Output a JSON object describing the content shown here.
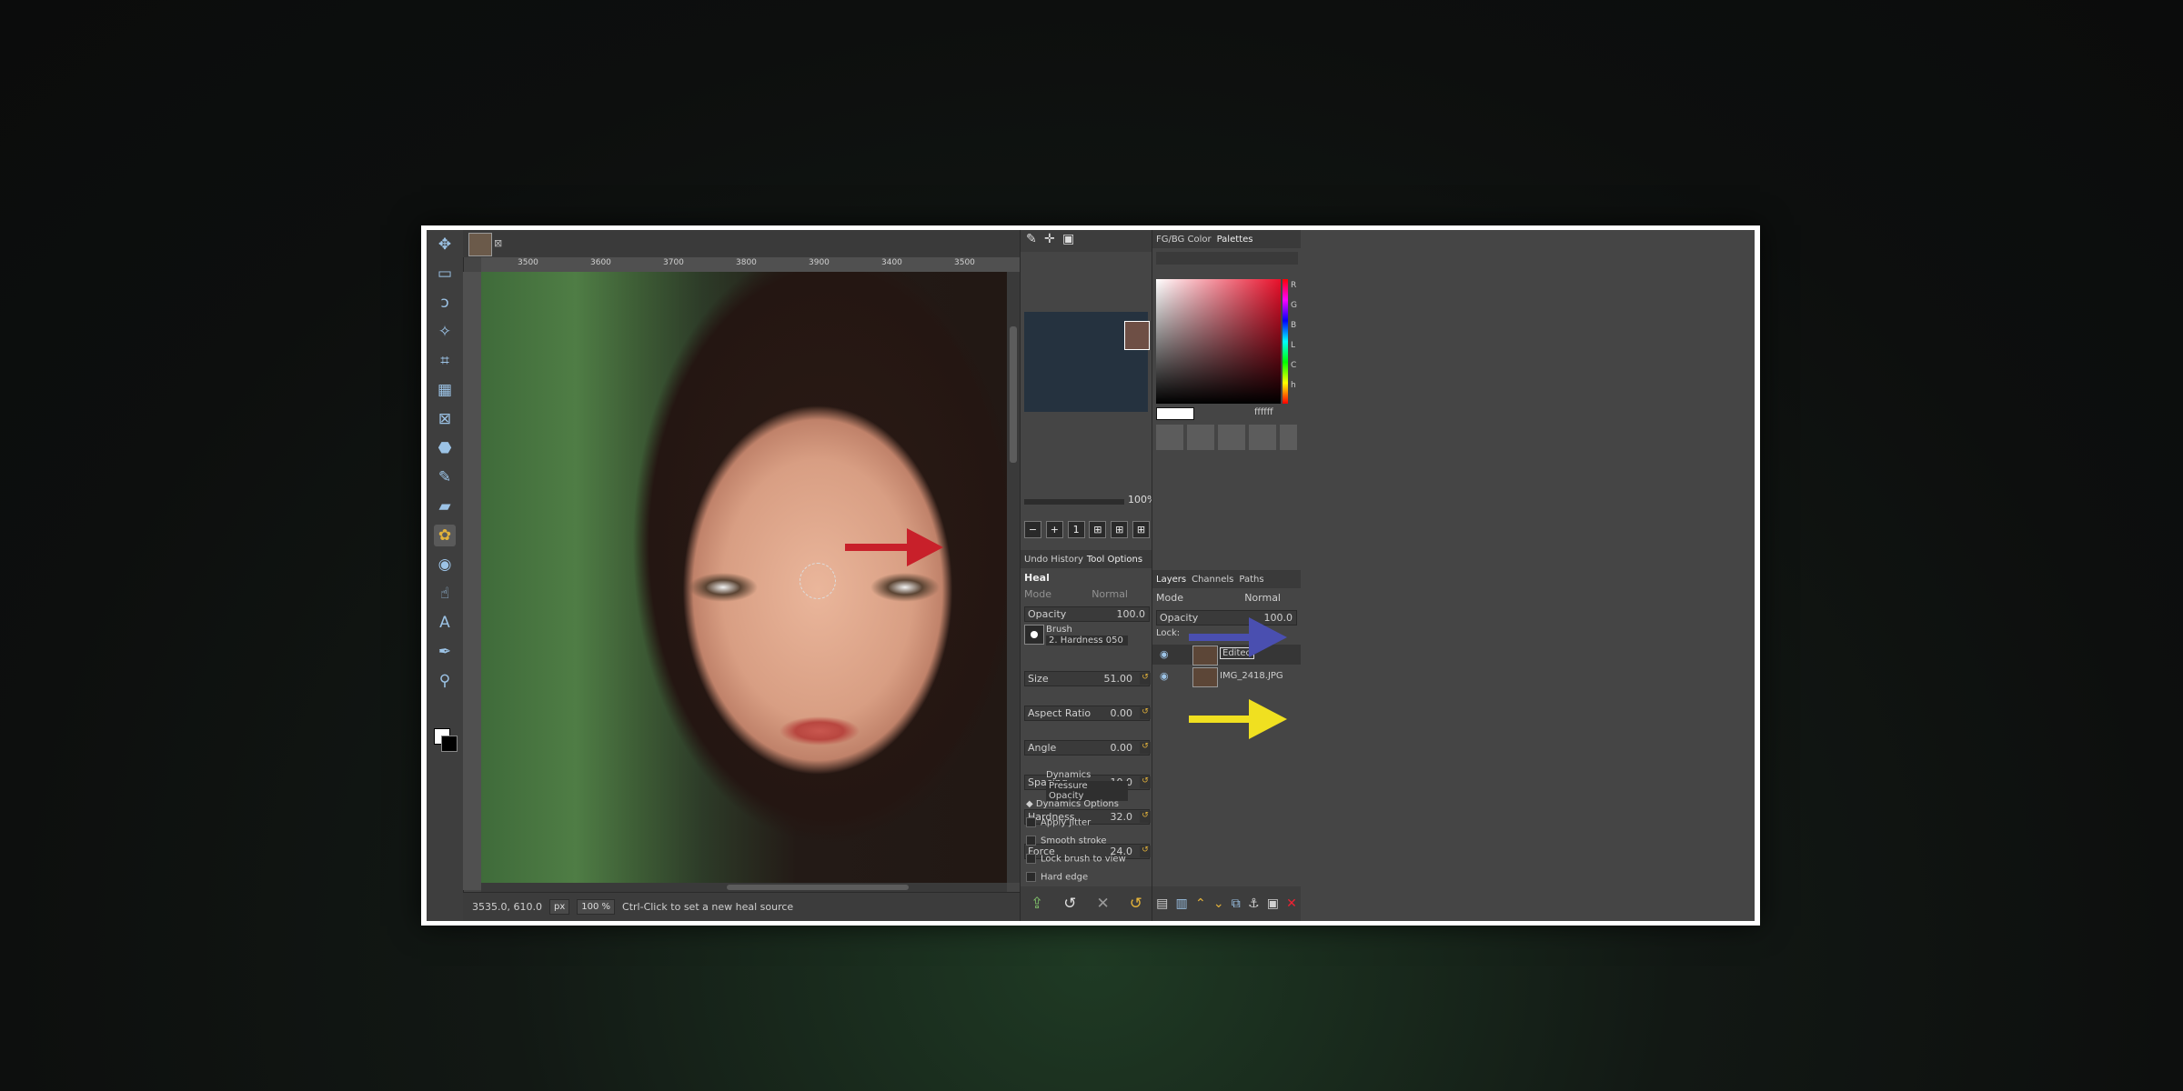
{
  "toolbox": {
    "icons": [
      "move-icon",
      "rect-select-icon",
      "lasso-icon",
      "fuzzy-select-icon",
      "crop-icon",
      "align-icon",
      "perspective-icon",
      "bucket-fill-icon",
      "paintbrush-icon",
      "eraser-icon",
      "heal-icon",
      "clone-icon",
      "smudge-icon",
      "text-icon",
      "path-icon",
      "zoom-icon"
    ],
    "fg_color": "#ffffff",
    "bg_color": "#000000"
  },
  "ruler": {
    "labels": [
      "3500",
      "3600",
      "3700",
      "3800",
      "3900",
      "3400",
      "3500",
      "3600",
      "3700",
      "3800"
    ]
  },
  "status": {
    "coords": "3535.0, 610.0",
    "unit": "px",
    "zoom": "100 %",
    "message": "Ctrl-Click to set a new heal source"
  },
  "navigator": {
    "zoom": "100%"
  },
  "tool_options": {
    "tabs": [
      "Undo History",
      "Tool Options"
    ],
    "tool_name": "Heal",
    "mode_label": "Mode",
    "mode_value": "Normal",
    "opacity_label": "Opacity",
    "opacity_value": "100.0",
    "brush_label": "Brush",
    "brush_value": "2. Hardness 050",
    "size_label": "Size",
    "size_value": "51.00",
    "aspect_label": "Aspect Ratio",
    "aspect_value": "0.00",
    "angle_label": "Angle",
    "angle_value": "0.00",
    "spacing_label": "Spacing",
    "spacing_value": "10.0",
    "hardness_label": "Hardness",
    "hardness_value": "32.0",
    "force_label": "Force",
    "force_value": "24.0",
    "dynamics_label": "Dynamics",
    "dynamics_value": "Pressure Opacity",
    "dynamics_options": "Dynamics Options",
    "checks": [
      "Apply Jitter",
      "Smooth stroke",
      "Lock brush to view",
      "Hard edge"
    ]
  },
  "color_panel": {
    "tabs": [
      "FG/BG Color",
      "Palettes"
    ],
    "channels": [
      "R",
      "G",
      "B",
      "L",
      "C",
      "h"
    ],
    "hex": "ffffff"
  },
  "layers_panel": {
    "tabs": [
      "Layers",
      "Channels",
      "Paths"
    ],
    "mode_label": "Mode",
    "mode_value": "Normal",
    "opacity_label": "Opacity",
    "opacity_value": "100.0",
    "lock_label": "Lock:",
    "layers": [
      {
        "name": "Edited",
        "selected": true
      },
      {
        "name": "IMG_2418.JPG",
        "selected": false
      }
    ]
  },
  "annotations": {
    "red": "#c8202a",
    "blue": "#4a4fb0",
    "yellow": "#f0e020"
  }
}
